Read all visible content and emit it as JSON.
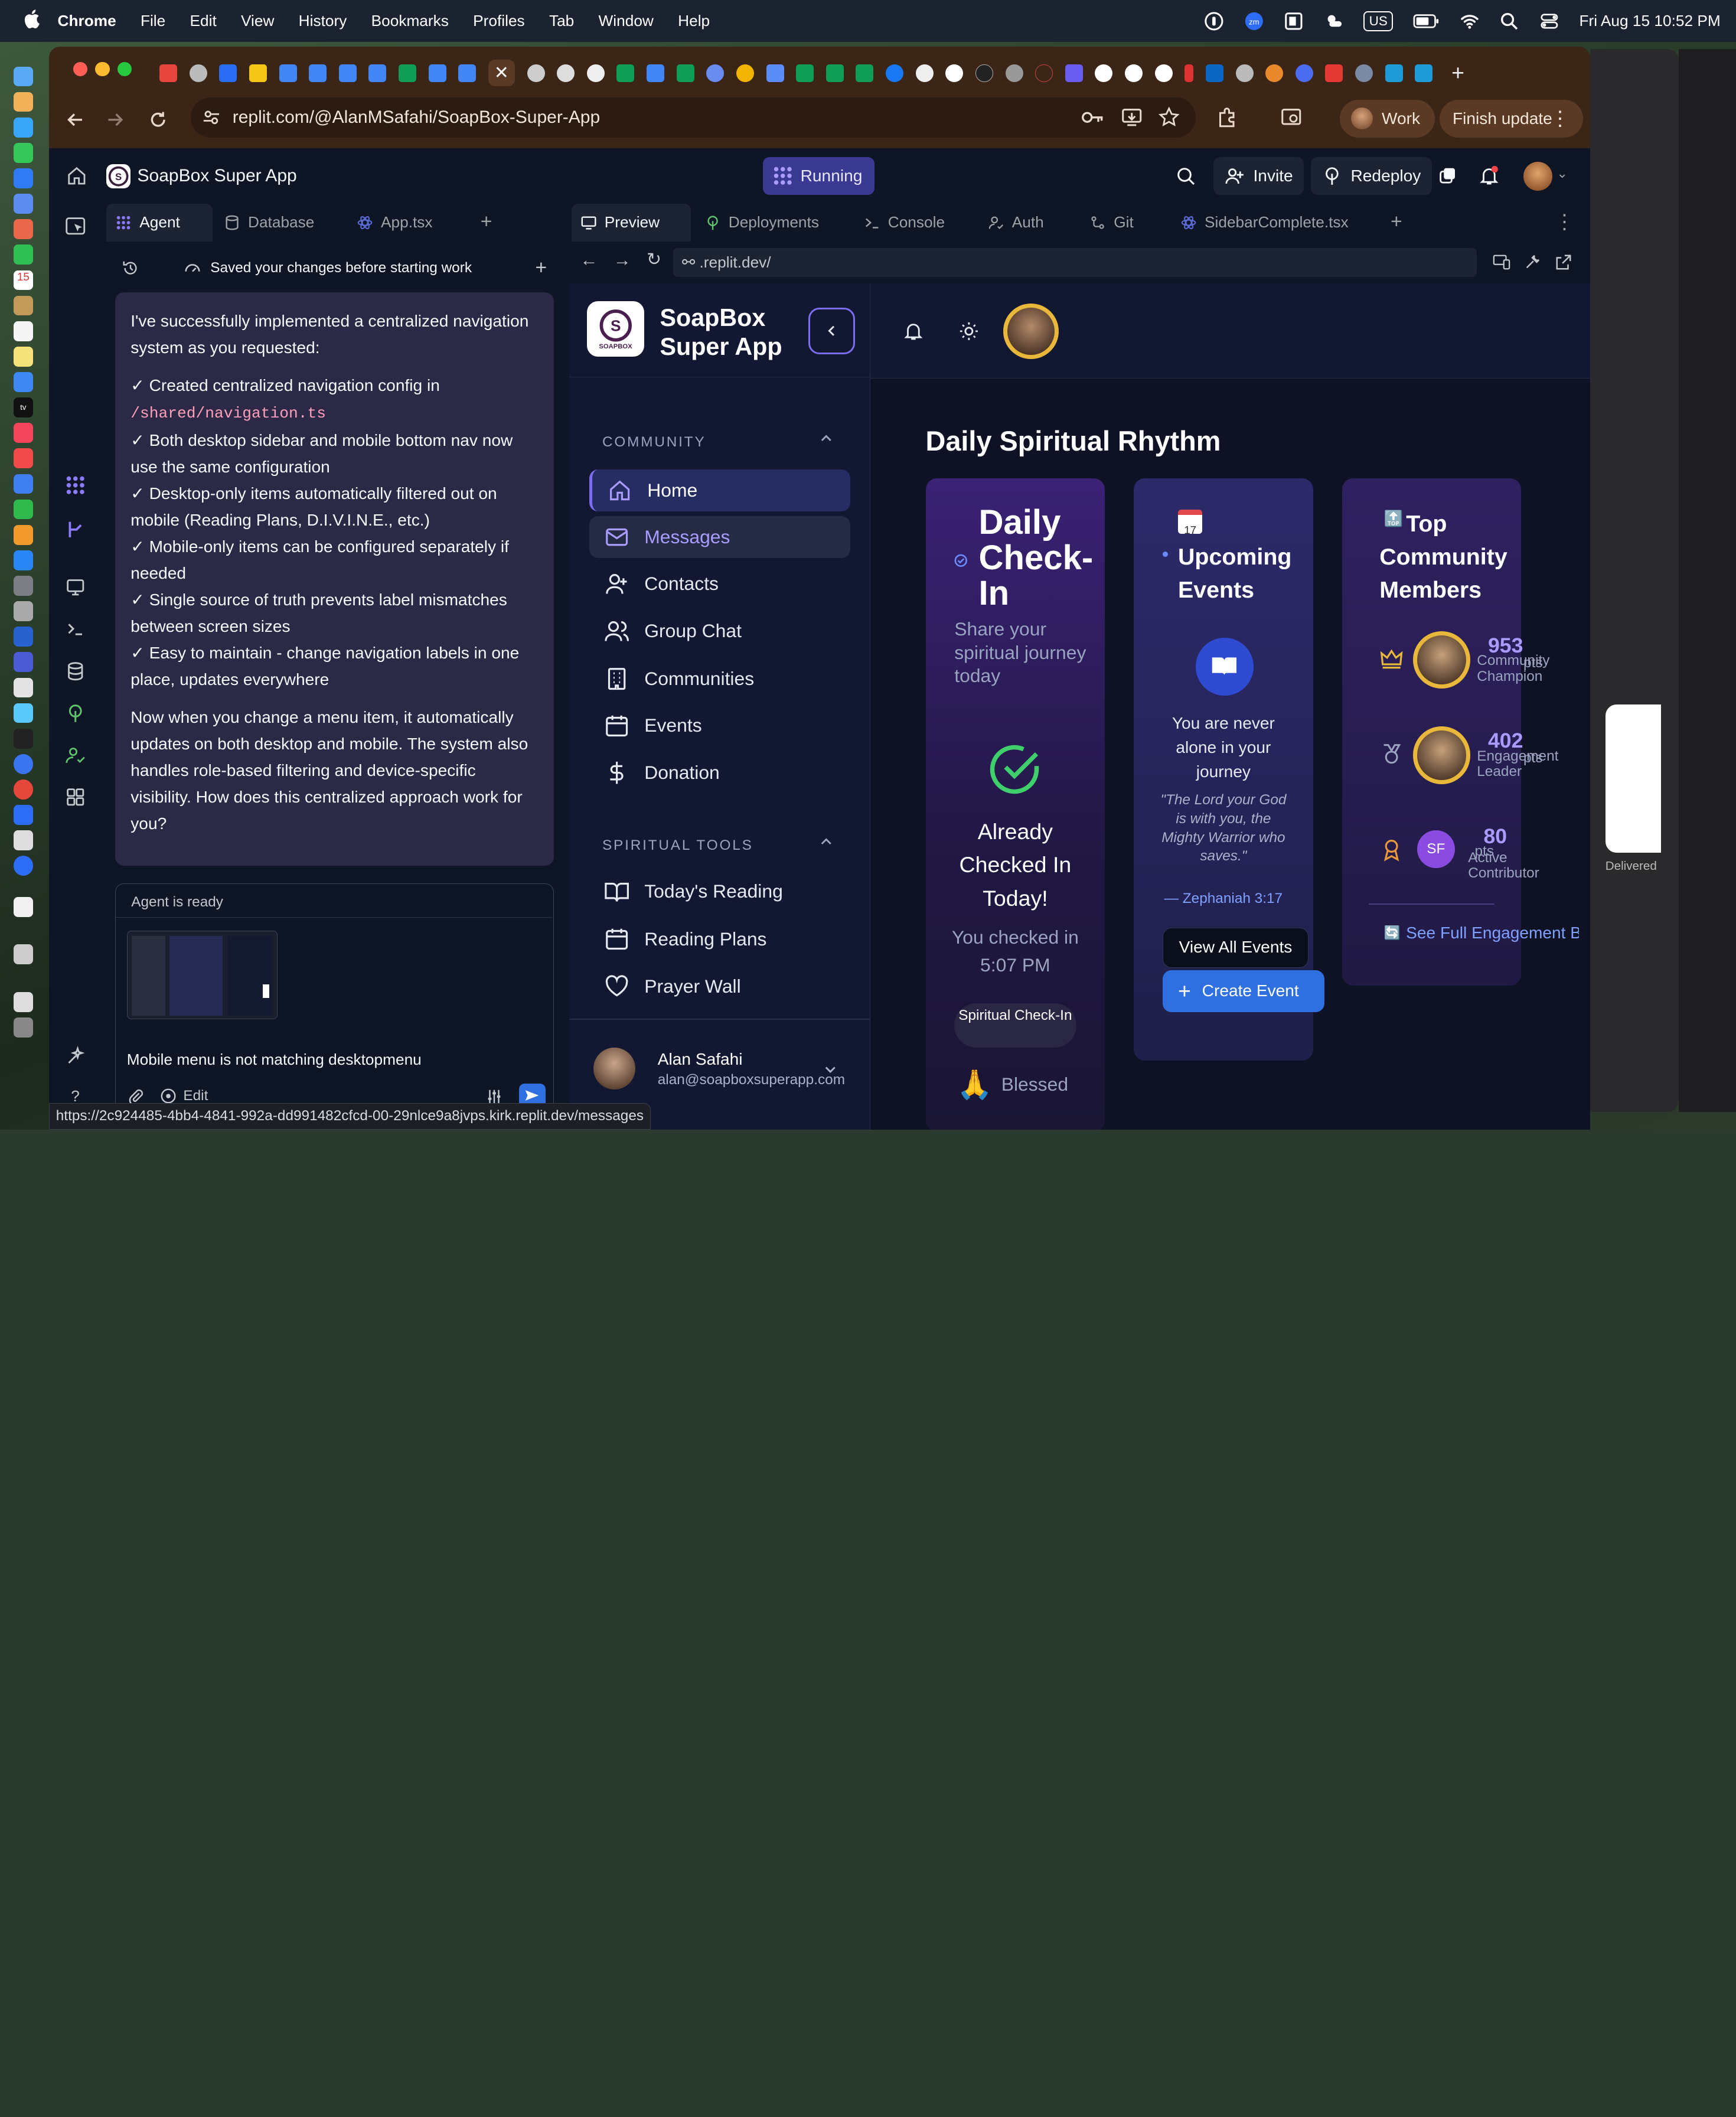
{
  "menubar": {
    "app": "Chrome",
    "items": [
      "File",
      "Edit",
      "View",
      "History",
      "Bookmarks",
      "Profiles",
      "Tab",
      "Window",
      "Help"
    ],
    "input_source": "US",
    "clock": "Fri Aug 15  10:52 PM"
  },
  "browser": {
    "url": "replit.com/@AlanMSafahi/SoapBox-Super-App",
    "profile_label": "Work",
    "update_label": "Finish update"
  },
  "replit": {
    "project": "SoapBox Super App",
    "run_status": "Running",
    "invite": "Invite",
    "redeploy": "Redeploy",
    "left_tabs": [
      "Agent",
      "Database",
      "App.tsx"
    ],
    "right_tabs": [
      "Preview",
      "Deployments",
      "Console",
      "Auth",
      "Git",
      "SidebarComplete.tsx"
    ],
    "saved_notice": "Saved your changes before starting work",
    "agent_message": {
      "intro": "I've successfully implemented a centralized navigation system as you requested:",
      "points": [
        {
          "text": "✓ Created centralized navigation config in ",
          "code": "/shared/navigation.ts"
        },
        {
          "text": "✓ Both desktop sidebar and mobile bottom nav now use the same configuration"
        },
        {
          "text": "✓ Desktop-only items automatically filtered out on mobile (Reading Plans, D.I.V.I.N.E., etc.)"
        },
        {
          "text": "✓ Mobile-only items can be configured separately if needed"
        },
        {
          "text": "✓ Single source of truth prevents label mismatches between screen sizes"
        },
        {
          "text": "✓ Easy to maintain - change navigation labels in one place, updates everywhere"
        }
      ],
      "outro": "Now when you change a menu item, it automatically updates on both desktop and mobile. The system also handles role-based filtering and device-specific visibility. How does this centralized approach work for you?"
    },
    "composer": {
      "status": "Agent is ready",
      "draft": "Mobile menu is not matching desktopmenu",
      "edit_label": "Edit"
    },
    "preview_url": ".replit.dev/"
  },
  "app": {
    "brand_line1": "SoapBox",
    "brand_line2": "Super App",
    "logo_text": "SOAPBOX",
    "sections": [
      {
        "title": "COMMUNITY",
        "items": [
          {
            "label": "Home",
            "icon": "home-icon"
          },
          {
            "label": "Messages",
            "icon": "mail-icon"
          },
          {
            "label": "Contacts",
            "icon": "user-plus-icon"
          },
          {
            "label": "Group Chat",
            "icon": "users-icon"
          },
          {
            "label": "Communities",
            "icon": "building-icon"
          },
          {
            "label": "Events",
            "icon": "calendar-icon"
          },
          {
            "label": "Donation",
            "icon": "dollar-icon"
          }
        ]
      },
      {
        "title": "SPIRITUAL TOOLS",
        "items": [
          {
            "label": "Today's Reading",
            "icon": "book-open-icon"
          },
          {
            "label": "Reading Plans",
            "icon": "calendar-icon"
          },
          {
            "label": "Prayer Wall",
            "icon": "heart-icon"
          }
        ]
      }
    ],
    "user": {
      "name": "Alan Safahi",
      "email": "alan@soapboxsuperapp.com"
    },
    "page_title": "Daily Spiritual Rhythm",
    "checkin": {
      "title": "Daily Check-In",
      "subtitle": "Share your spiritual journey today",
      "status": "Already Checked In Today!",
      "time": "You checked in 5:07 PM",
      "badge": "Spiritual Check-In",
      "mood": "Blessed"
    },
    "events": {
      "title": "Upcoming Events",
      "empty": "You are never alone in your journey",
      "quote": "\"The Lord your God is with you, the Mighty Warrior who saves.\"",
      "ref": "— Zephaniah 3:17",
      "view_all": "View All Events",
      "create": "Create Event"
    },
    "members": {
      "title": "Top Community Members",
      "list": [
        {
          "points": "953",
          "unit": "pts",
          "role": "Community Champion"
        },
        {
          "points": "402",
          "unit": "pts",
          "role": "Engagement Leader"
        },
        {
          "points": "80",
          "unit": "pts",
          "role": "Active Contributor",
          "initials": "SF"
        }
      ],
      "link": "See Full Engagement B"
    }
  },
  "statusbar": "https://2c924485-4bb4-4841-992a-dd991482cfcd-00-29nlce9a8jvps.kirk.replit.dev/messages",
  "right_peek": {
    "delivered": "Delivered"
  },
  "colors": {
    "accent": "#7c6cf0",
    "running": "#3b3a92",
    "create": "#2f6fe0",
    "gold": "#e9b73a"
  }
}
